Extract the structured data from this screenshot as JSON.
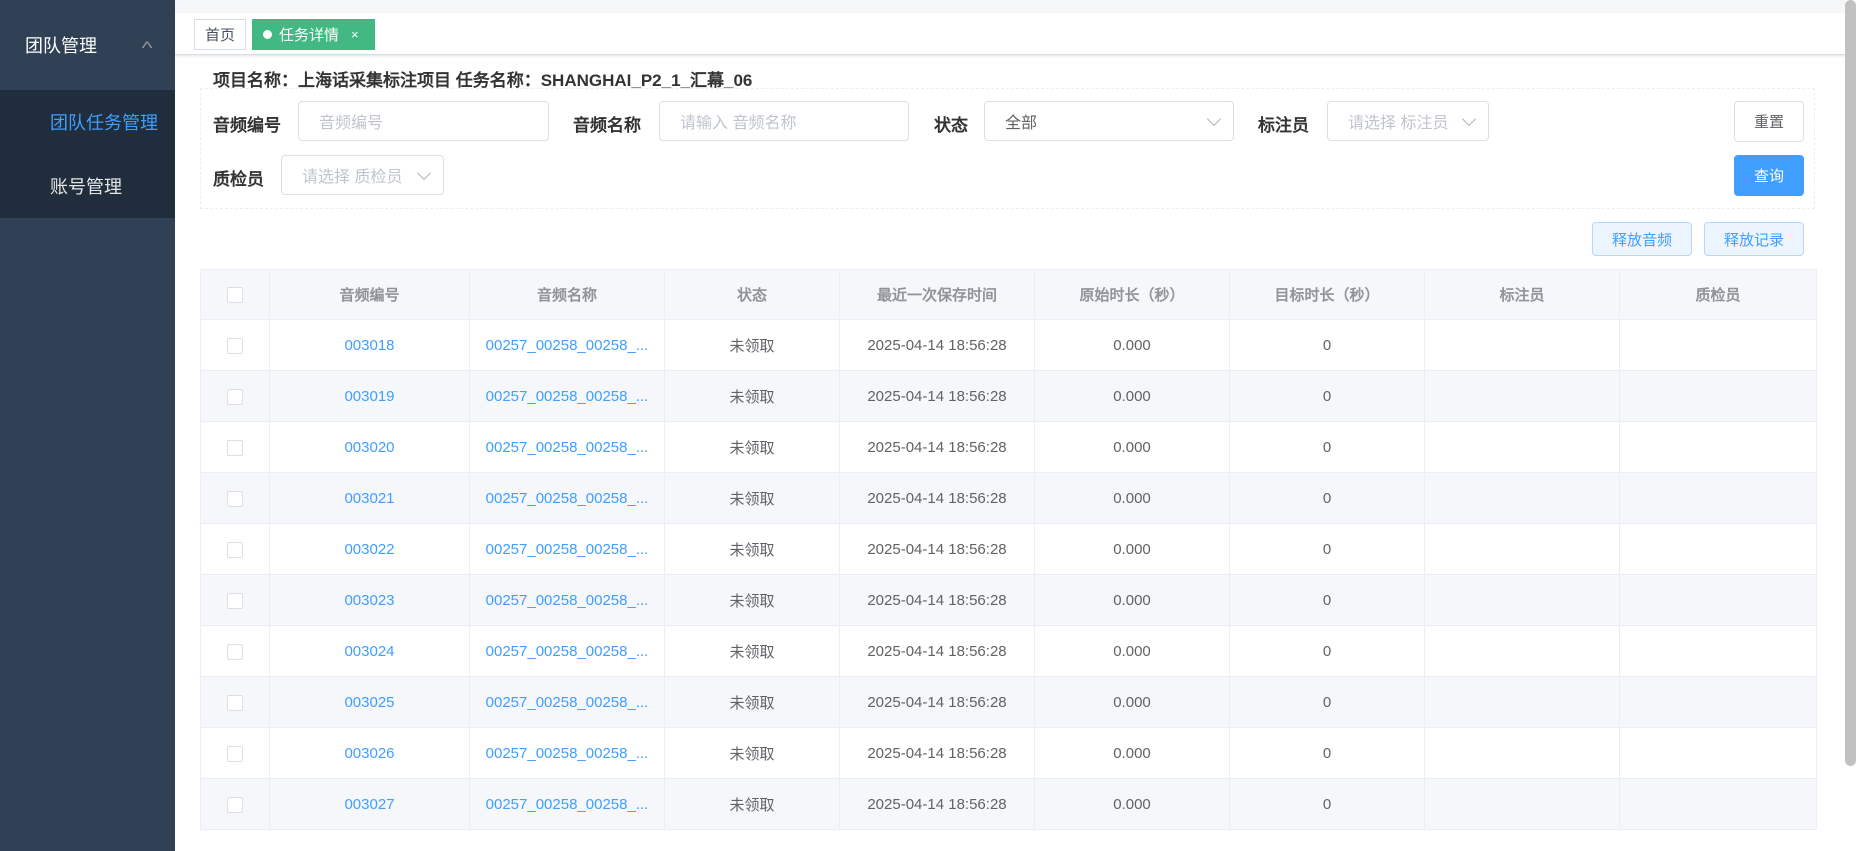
{
  "sidebar": {
    "group_label": "团队管理",
    "items": [
      {
        "label": "团队任务管理",
        "active": true
      },
      {
        "label": "账号管理",
        "active": false
      }
    ]
  },
  "tags": {
    "home": "首页",
    "active": "任务详情",
    "close": "×"
  },
  "project_line": "项目名称：上海话采集标注项目 任务名称：SHANGHAI_P2_1_汇幕_06",
  "filters": {
    "audio_id_label": "音频编号",
    "audio_id_placeholder": "音频编号",
    "audio_name_label": "音频名称",
    "audio_name_placeholder": "请输入 音频名称",
    "status_label": "状态",
    "status_value": "全部",
    "annotator_label": "标注员",
    "annotator_placeholder": "请选择 标注员",
    "inspector_label": "质检员",
    "inspector_placeholder": "请选择 质检员",
    "reset": "重置",
    "query": "查询"
  },
  "actions": {
    "release_audio": "释放音频",
    "release_record": "释放记录"
  },
  "table": {
    "headers": [
      "音频编号",
      "音频名称",
      "状态",
      "最近一次保存时间",
      "原始时长（秒）",
      "目标时长（秒）",
      "标注员",
      "质检员"
    ],
    "rows": [
      {
        "id": "003018",
        "name": "00257_00258_00258_...",
        "status": "未领取",
        "saved": "2025-04-14 18:56:28",
        "orig": "0.000",
        "target": "0",
        "annotator": "",
        "inspector": ""
      },
      {
        "id": "003019",
        "name": "00257_00258_00258_...",
        "status": "未领取",
        "saved": "2025-04-14 18:56:28",
        "orig": "0.000",
        "target": "0",
        "annotator": "",
        "inspector": ""
      },
      {
        "id": "003020",
        "name": "00257_00258_00258_...",
        "status": "未领取",
        "saved": "2025-04-14 18:56:28",
        "orig": "0.000",
        "target": "0",
        "annotator": "",
        "inspector": ""
      },
      {
        "id": "003021",
        "name": "00257_00258_00258_...",
        "status": "未领取",
        "saved": "2025-04-14 18:56:28",
        "orig": "0.000",
        "target": "0",
        "annotator": "",
        "inspector": ""
      },
      {
        "id": "003022",
        "name": "00257_00258_00258_...",
        "status": "未领取",
        "saved": "2025-04-14 18:56:28",
        "orig": "0.000",
        "target": "0",
        "annotator": "",
        "inspector": ""
      },
      {
        "id": "003023",
        "name": "00257_00258_00258_...",
        "status": "未领取",
        "saved": "2025-04-14 18:56:28",
        "orig": "0.000",
        "target": "0",
        "annotator": "",
        "inspector": ""
      },
      {
        "id": "003024",
        "name": "00257_00258_00258_...",
        "status": "未领取",
        "saved": "2025-04-14 18:56:28",
        "orig": "0.000",
        "target": "0",
        "annotator": "",
        "inspector": ""
      },
      {
        "id": "003025",
        "name": "00257_00258_00258_...",
        "status": "未领取",
        "saved": "2025-04-14 18:56:28",
        "orig": "0.000",
        "target": "0",
        "annotator": "",
        "inspector": ""
      },
      {
        "id": "003026",
        "name": "00257_00258_00258_...",
        "status": "未领取",
        "saved": "2025-04-14 18:56:28",
        "orig": "0.000",
        "target": "0",
        "annotator": "",
        "inspector": ""
      },
      {
        "id": "003027",
        "name": "00257_00258_00258_...",
        "status": "未领取",
        "saved": "2025-04-14 18:56:28",
        "orig": "0.000",
        "target": "0",
        "annotator": "",
        "inspector": ""
      }
    ]
  }
}
